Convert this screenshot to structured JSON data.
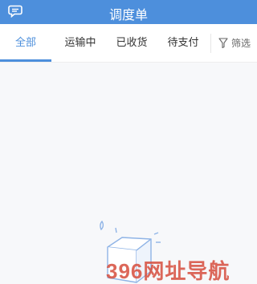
{
  "header": {
    "title": "调度单",
    "left_icon": "message-icon",
    "background_color": "#4d8fdc"
  },
  "tabs": [
    {
      "label": "全部",
      "active": true
    },
    {
      "label": "运输中",
      "active": false
    },
    {
      "label": "已收货",
      "active": false
    },
    {
      "label": "待支付",
      "active": false
    }
  ],
  "filter": {
    "label": "筛选",
    "icon": "filter-icon"
  },
  "empty_state": {
    "icon": "empty-box-icon"
  },
  "watermark": {
    "text": "396网址导航"
  },
  "colors": {
    "accent": "#4d8fdc",
    "background": "#f7f8fa"
  }
}
